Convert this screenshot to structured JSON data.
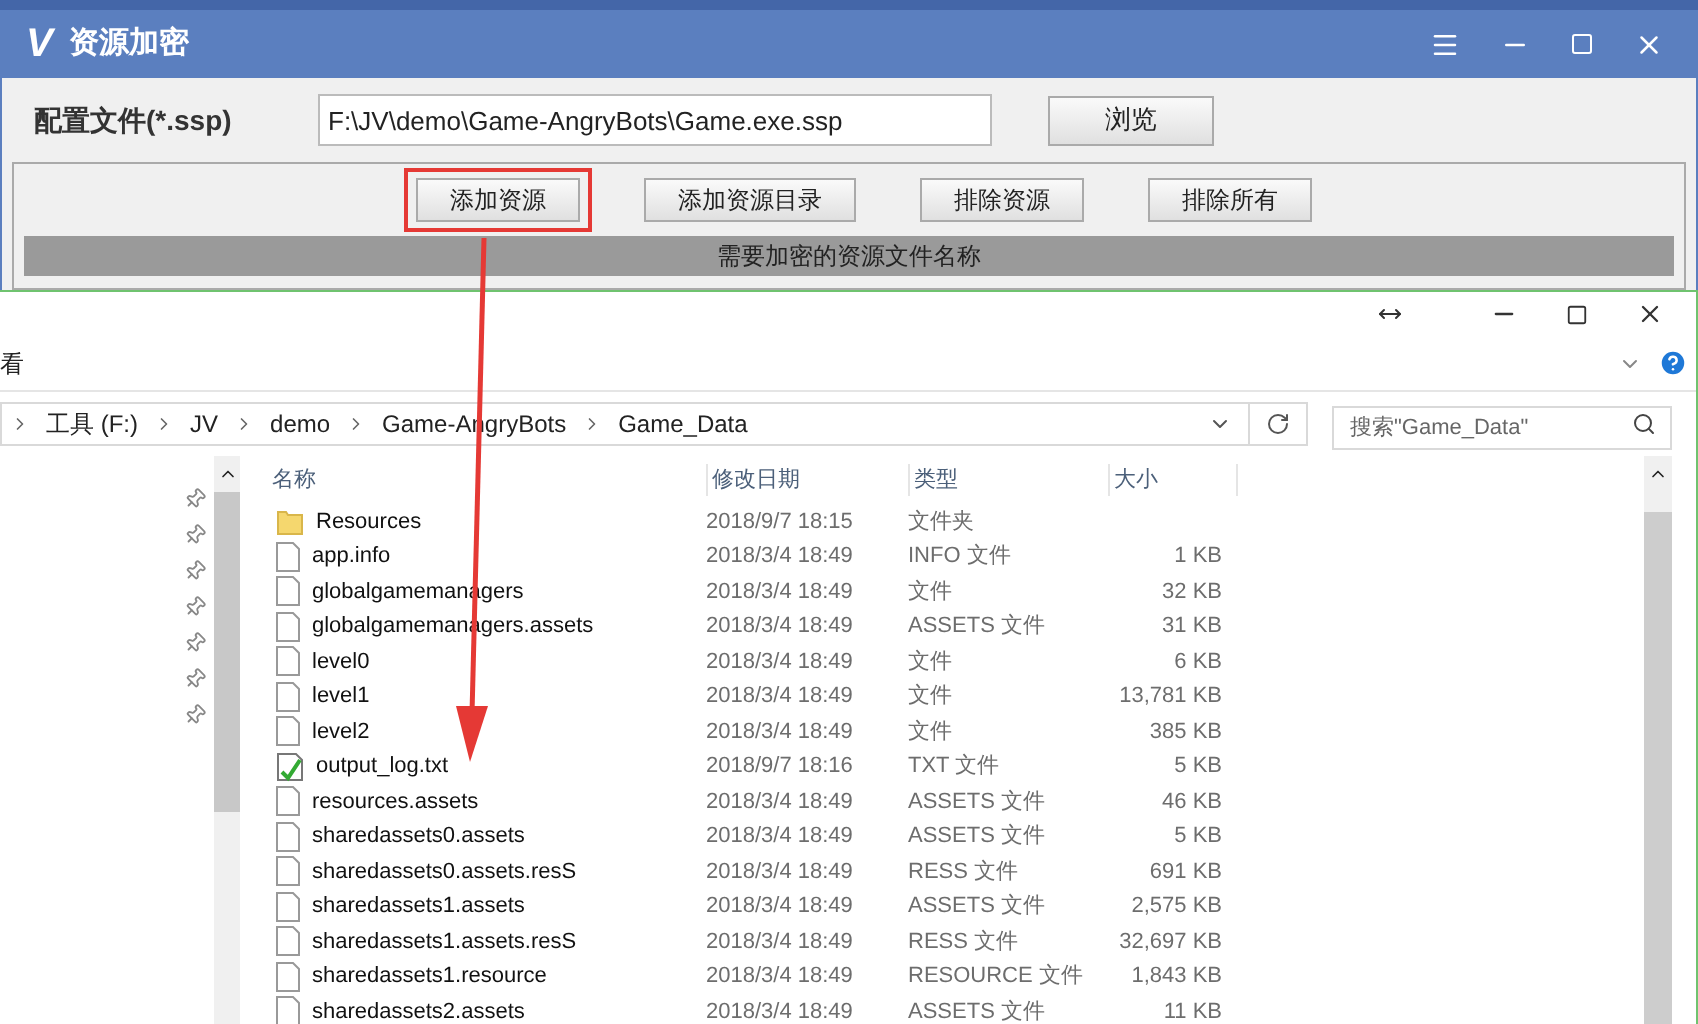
{
  "app_window": {
    "title": "资源加密",
    "logo": "V",
    "config_label": "配置文件(*.ssp)",
    "config_value": "F:\\JV\\demo\\Game-AngryBots\\Game.exe.ssp",
    "browse_button": "浏览",
    "buttons": [
      {
        "label": "添加资源",
        "highlighted": true
      },
      {
        "label": "添加资源目录",
        "highlighted": false
      },
      {
        "label": "排除资源",
        "highlighted": false
      },
      {
        "label": "排除所有",
        "highlighted": false
      }
    ],
    "list_header": "需要加密的资源文件名称"
  },
  "explorer": {
    "ribbon_tab": "看",
    "breadcrumb": [
      "工具 (F:)",
      "JV",
      "demo",
      "Game-AngryBots",
      "Game_Data"
    ],
    "search": {
      "placeholder": "搜索\"Game_Data\""
    },
    "columns": [
      "名称",
      "修改日期",
      "类型",
      "大小"
    ],
    "rows": [
      {
        "kind": "folder",
        "name": "Resources",
        "date": "2018/9/7 18:15",
        "type": "文件夹",
        "size": ""
      },
      {
        "kind": "file",
        "name": "app.info",
        "date": "2018/3/4 18:49",
        "type": "INFO 文件",
        "size": "1 KB"
      },
      {
        "kind": "file",
        "name": "globalgamemanagers",
        "date": "2018/3/4 18:49",
        "type": "文件",
        "size": "32 KB"
      },
      {
        "kind": "file",
        "name": "globalgamemanagers.assets",
        "date": "2018/3/4 18:49",
        "type": "ASSETS 文件",
        "size": "31 KB"
      },
      {
        "kind": "file",
        "name": "level0",
        "date": "2018/3/4 18:49",
        "type": "文件",
        "size": "6 KB"
      },
      {
        "kind": "file",
        "name": "level1",
        "date": "2018/3/4 18:49",
        "type": "文件",
        "size": "13,781 KB"
      },
      {
        "kind": "file",
        "name": "level2",
        "date": "2018/3/4 18:49",
        "type": "文件",
        "size": "385 KB"
      },
      {
        "kind": "text",
        "name": "output_log.txt",
        "date": "2018/9/7 18:16",
        "type": "TXT 文件",
        "size": "5 KB"
      },
      {
        "kind": "file",
        "name": "resources.assets",
        "date": "2018/3/4 18:49",
        "type": "ASSETS 文件",
        "size": "46 KB"
      },
      {
        "kind": "file",
        "name": "sharedassets0.assets",
        "date": "2018/3/4 18:49",
        "type": "ASSETS 文件",
        "size": "5 KB"
      },
      {
        "kind": "file",
        "name": "sharedassets0.assets.resS",
        "date": "2018/3/4 18:49",
        "type": "RESS 文件",
        "size": "691 KB"
      },
      {
        "kind": "file",
        "name": "sharedassets1.assets",
        "date": "2018/3/4 18:49",
        "type": "ASSETS 文件",
        "size": "2,575 KB"
      },
      {
        "kind": "file",
        "name": "sharedassets1.assets.resS",
        "date": "2018/3/4 18:49",
        "type": "RESS 文件",
        "size": "32,697 KB"
      },
      {
        "kind": "file",
        "name": "sharedassets1.resource",
        "date": "2018/3/4 18:49",
        "type": "RESOURCE 文件",
        "size": "1,843 KB"
      },
      {
        "kind": "file",
        "name": "sharedassets2.assets",
        "date": "2018/3/4 18:49",
        "type": "ASSETS 文件",
        "size": "11 KB"
      }
    ]
  }
}
